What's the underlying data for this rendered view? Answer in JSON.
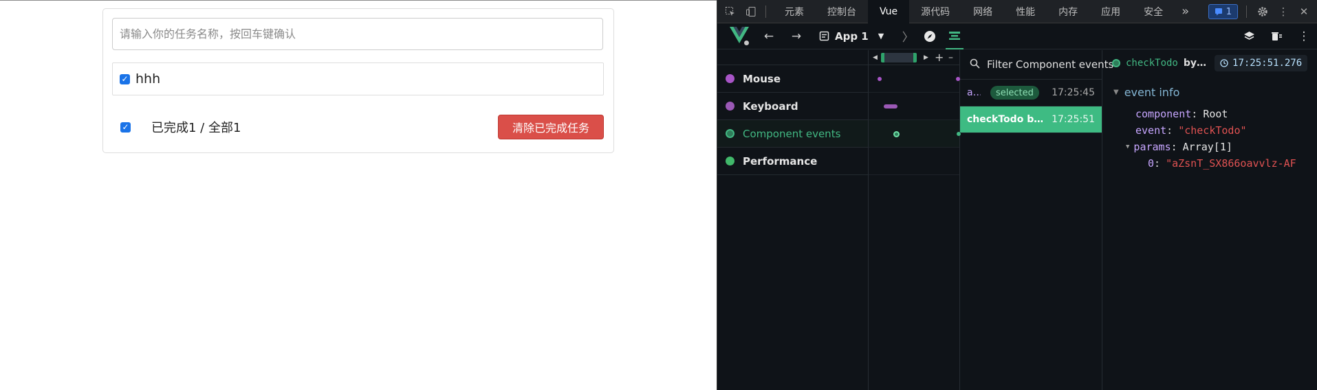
{
  "todo": {
    "input_placeholder": "请输入你的任务名称，按回车键确认",
    "items": [
      {
        "label": "hhh",
        "checked": true
      }
    ],
    "footer_text": "已完成1 / 全部1",
    "clear_button": "清除已完成任务"
  },
  "devtools": {
    "tabs": [
      "元素",
      "控制台",
      "Vue",
      "源代码",
      "网络",
      "性能",
      "内存",
      "应用",
      "安全"
    ],
    "more_tabs": "»",
    "issues_count": "1",
    "app_select": "App 1",
    "layers": [
      {
        "label": "Mouse",
        "color": "#a855c7"
      },
      {
        "label": "Keyboard",
        "color": "#9b59b6"
      },
      {
        "label": "Component events",
        "color": "#42b883"
      },
      {
        "label": "Performance",
        "color": "#41b86a"
      }
    ],
    "timeline_plus": "+",
    "timeline_minus": "–",
    "filter_placeholder": "Filter Component events",
    "events": [
      {
        "name": "a…",
        "tag": "selected",
        "time": "17:25:45"
      },
      {
        "name": "checkTodo b…",
        "time": "17:25:51"
      }
    ],
    "inspector": {
      "title": "checkTodo",
      "by": "by…",
      "time": "17:25:51.276",
      "section": "event info",
      "fields": [
        {
          "key": "component",
          "value": "Root",
          "type": "plain"
        },
        {
          "key": "event",
          "value": "\"checkTodo\"",
          "type": "string"
        }
      ],
      "params_key": "params",
      "params_value": "Array[1]",
      "param_index": "0",
      "param_value": "\"aZsnT_SX866oavvlz-AF"
    }
  }
}
